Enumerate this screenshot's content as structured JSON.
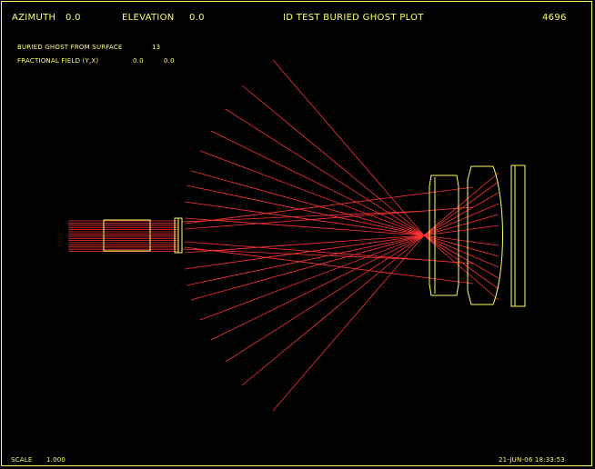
{
  "header": {
    "azimuth_label": "AZIMUTH",
    "azimuth_value": "0.0",
    "elevation_label": "ELEVATION",
    "elevation_value": "0.0",
    "title": "ID TEST BURIED GHOST PLOT",
    "id_number": "4696"
  },
  "info": {
    "ghost_label": "BURIED GHOST FROM SURFACE",
    "ghost_surface": "13",
    "field_label": "FRACTIONAL FIELD (Y,X)",
    "field_y": "0.0",
    "field_x": "0.0"
  },
  "footer": {
    "scale_label": "SCALE",
    "scale_value": "1.000",
    "date_time": "21-JUN-06 18:33:53"
  },
  "colors": {
    "lens_outline": "#ffff66",
    "ray": "#ff3333",
    "background": "#000000"
  }
}
